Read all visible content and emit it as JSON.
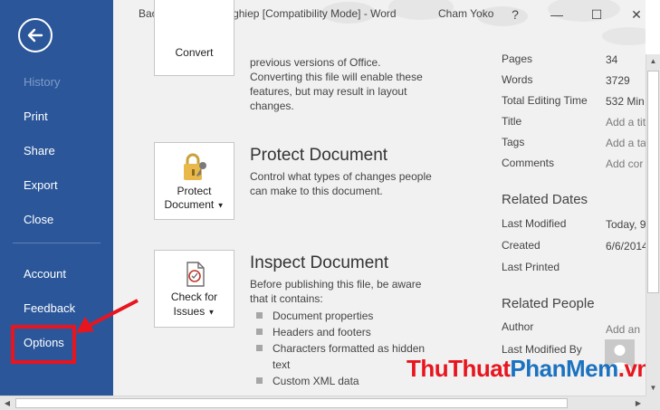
{
  "window": {
    "title": "Bao cao do an tot nghiep [Compatibility Mode]  -  Word",
    "user": "Cham Yoko",
    "help": "?",
    "minimize": "—",
    "maximize": "☐",
    "close": "✕"
  },
  "nav": {
    "items": [
      {
        "label": "History"
      },
      {
        "label": "Print"
      },
      {
        "label": "Share"
      },
      {
        "label": "Export"
      },
      {
        "label": "Close"
      },
      {
        "label": "Account"
      },
      {
        "label": "Feedback"
      },
      {
        "label": "Options"
      }
    ]
  },
  "sections": {
    "convert": {
      "button": "Convert",
      "desc_lines": [
        "previous versions of Office.",
        "Converting this file will enable these",
        "features, but may result in layout",
        "changes."
      ]
    },
    "protect": {
      "title": "Protect Document",
      "button_line1": "Protect",
      "button_line2": "Document",
      "desc_lines": [
        "Control what types of changes people",
        "can make to this document."
      ]
    },
    "inspect": {
      "title": "Inspect Document",
      "button_line1": "Check for",
      "button_line2": "Issues",
      "desc_lines": [
        "Before publishing this file, be aware",
        "that it contains:"
      ],
      "bullets": [
        "Document properties",
        "Headers and footers",
        "Characters formatted as hidden text",
        "Custom XML data"
      ]
    }
  },
  "properties": {
    "items": [
      {
        "label": "Pages",
        "value": "34"
      },
      {
        "label": "Words",
        "value": "3729"
      },
      {
        "label": "Total Editing Time",
        "value": "532 Min"
      },
      {
        "label": "Title",
        "value": "Add a tit"
      },
      {
        "label": "Tags",
        "value": "Add a ta"
      },
      {
        "label": "Comments",
        "value": "Add cor"
      }
    ]
  },
  "related_dates": {
    "title": "Related Dates",
    "items": [
      {
        "label": "Last Modified",
        "value": "Today, 9"
      },
      {
        "label": "Created",
        "value": "6/6/2014"
      },
      {
        "label": "Last Printed",
        "value": ""
      }
    ]
  },
  "related_people": {
    "title": "Related People",
    "author_label": "Author",
    "author_value": "Add an",
    "last_modified_by_label": "Last Modified By"
  },
  "watermark": {
    "part1": "ThuThuat",
    "part2": "PhanMem",
    "part3": ".vn"
  },
  "colors": {
    "nav": "#2b579a",
    "highlight": "#e8151f",
    "background": "#f1f1f1"
  }
}
